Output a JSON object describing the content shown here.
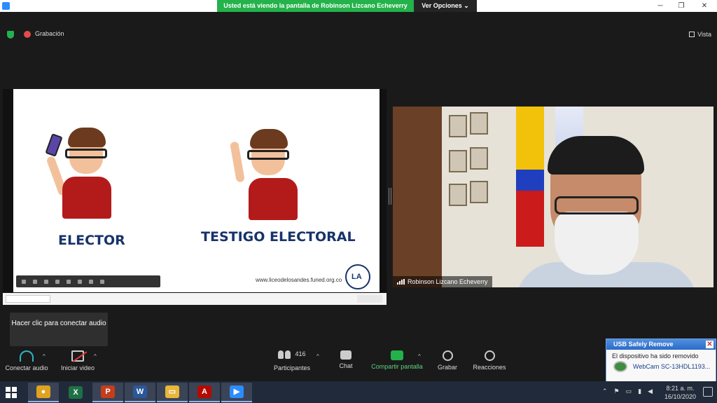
{
  "titlebar": {
    "share_message": "Usted está viendo la pantalla de Robinson Lizcano Echeverry",
    "view_options": "Ver Opciones ⌄",
    "minimize": "─",
    "restore": "❐",
    "close": "✕"
  },
  "meeting": {
    "recording_label": "Grabación",
    "view_label": "Vista"
  },
  "slide": {
    "label_left": "ELECTOR",
    "label_right": "TESTIGO ELECTORAL",
    "url": "www.liceodelosandes.funed.org.co",
    "logo_text": "LA"
  },
  "video": {
    "participant_name": "Robinson Lizcano Echeverry"
  },
  "tooltip": {
    "text": "Hacer clic para conectar audio"
  },
  "controls": {
    "audio": "Conectar audio",
    "video": "Iniciar video",
    "participants": "Participantes",
    "participants_count": "416",
    "chat": "Chat",
    "share": "Compartir pantalla",
    "record": "Grabar",
    "reactions": "Reacciones",
    "caret": "^"
  },
  "usb_popup": {
    "title": "USB Safely Remove",
    "message": "El dispositivo ha sido removido",
    "device": "WebCam SC-13HDL1193...",
    "close": "✕"
  },
  "taskbar": {
    "apps": [
      {
        "name": "chrome",
        "glyph": "●",
        "color": "#e0a21f"
      },
      {
        "name": "excel",
        "glyph": "X",
        "color": "#1e7145"
      },
      {
        "name": "powerpoint",
        "glyph": "P",
        "color": "#c43e1c"
      },
      {
        "name": "word",
        "glyph": "W",
        "color": "#2b579a"
      },
      {
        "name": "file-explorer",
        "glyph": "▭",
        "color": "#e8b73a"
      },
      {
        "name": "acrobat",
        "glyph": "A",
        "color": "#b30b00"
      },
      {
        "name": "zoom",
        "glyph": "▶",
        "color": "#2d8cff"
      }
    ],
    "time": "8:21 a. m.",
    "date": "16/10/2020"
  },
  "colors": {
    "share_green": "#24b24b",
    "accent_blue": "#2d8cff",
    "slide_text": "#17336b"
  }
}
